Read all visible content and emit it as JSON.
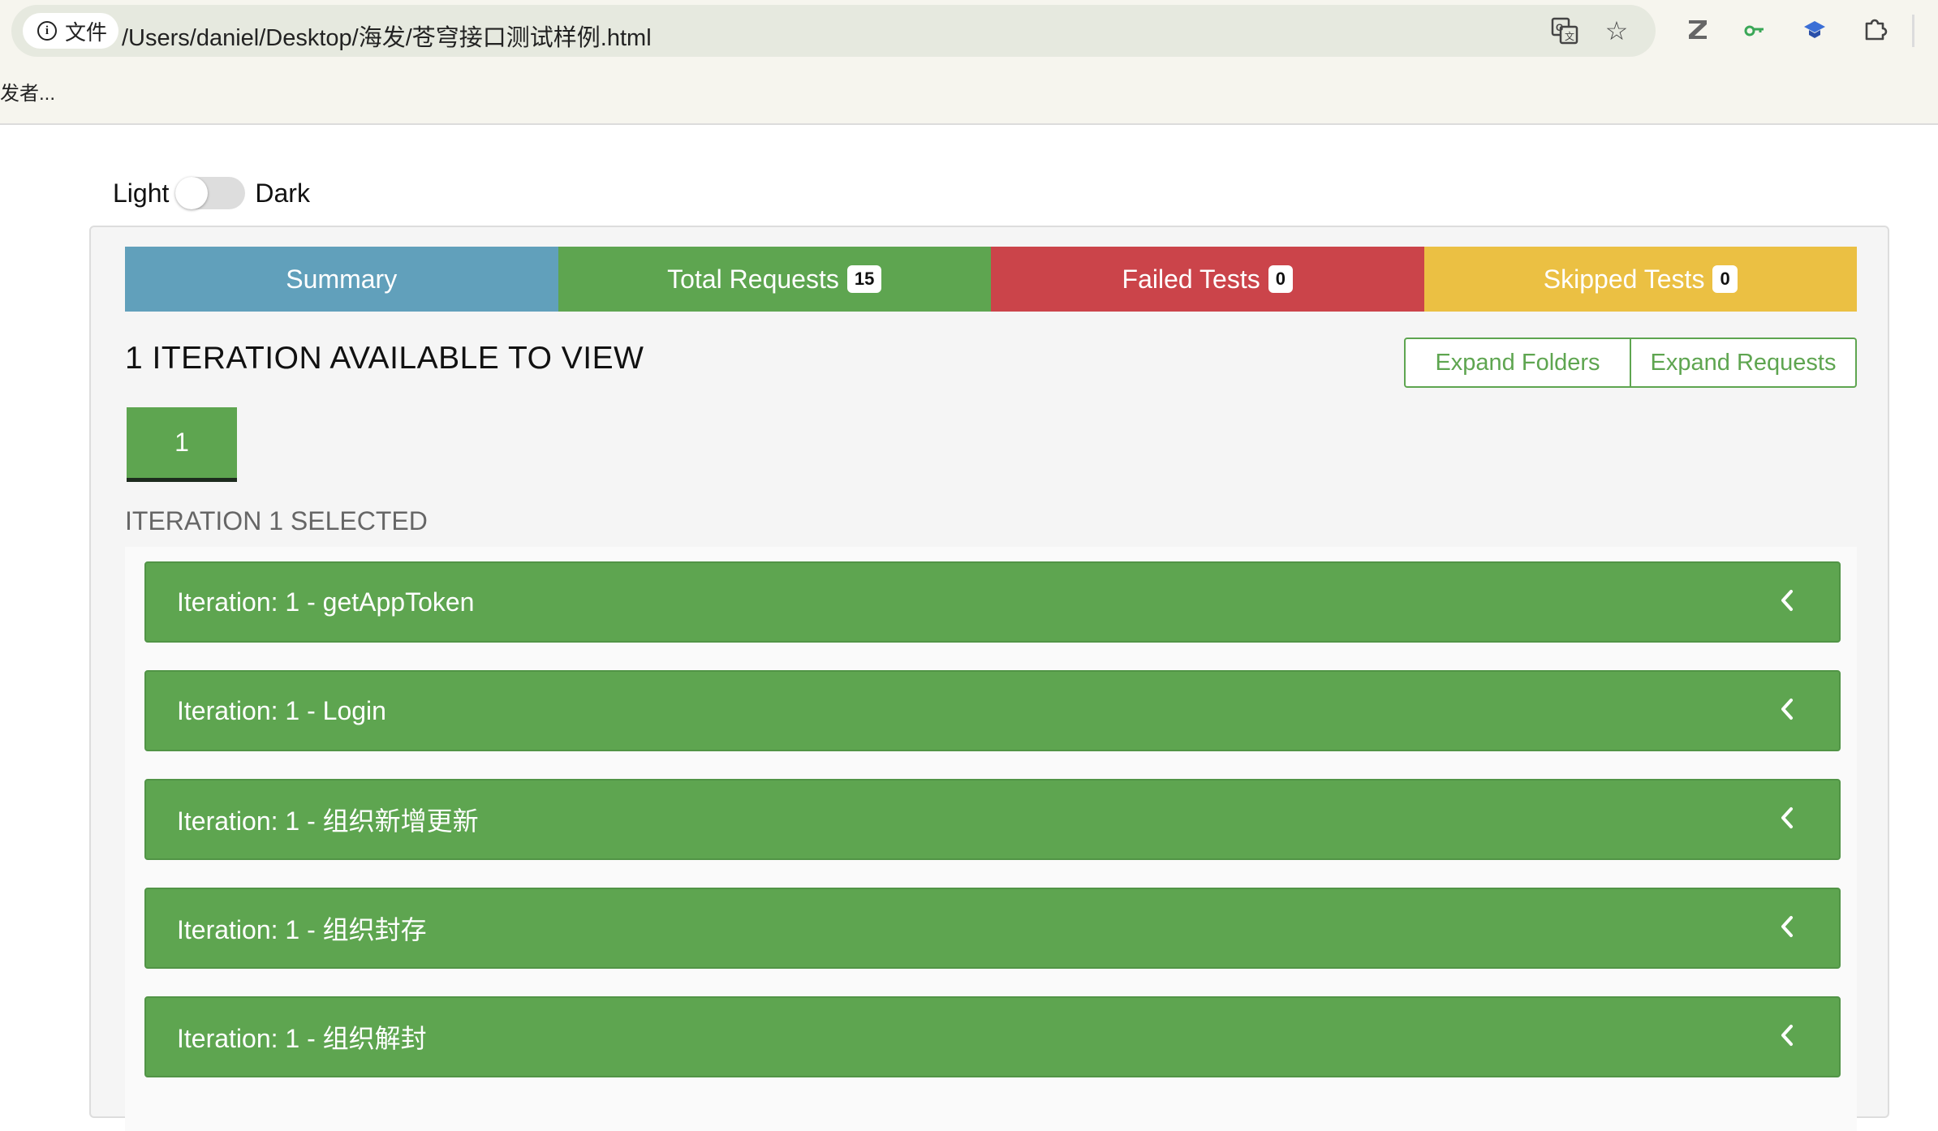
{
  "browser": {
    "site_label": "文件",
    "url": "/Users/daniel/Desktop/海发/苍穹接口测试样例.html",
    "bookmark_text": "发者..."
  },
  "theme": {
    "light_label": "Light",
    "dark_label": "Dark",
    "dark_enabled": false
  },
  "tabs": [
    {
      "label": "Summary",
      "count": null,
      "color": "#61a0bb"
    },
    {
      "label": "Total Requests",
      "count": "15",
      "color": "#5ea550"
    },
    {
      "label": "Failed Tests",
      "count": "0",
      "color": "#cb444a"
    },
    {
      "label": "Skipped Tests",
      "count": "0",
      "color": "#ebc043"
    }
  ],
  "heading": "1 ITERATION AVAILABLE TO VIEW",
  "buttons": {
    "expand_folders": "Expand Folders",
    "expand_requests": "Expand Requests"
  },
  "iteration_tab": "1",
  "selected_label": "ITERATION 1 SELECTED",
  "requests": [
    "Iteration: 1 - getAppToken",
    "Iteration: 1 - Login",
    "Iteration: 1 - 组织新增更新",
    "Iteration: 1 - 组织封存",
    "Iteration: 1 - 组织解封"
  ]
}
